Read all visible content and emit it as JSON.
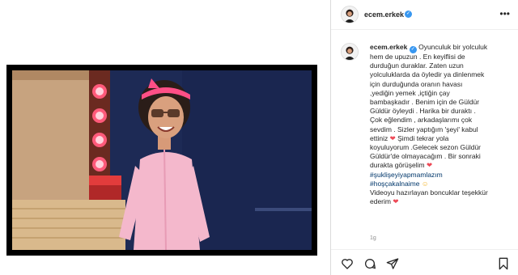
{
  "post": {
    "username": "ecem.erkek",
    "verified": true
  },
  "caption": {
    "username": "ecem.erkek",
    "lines": [
      "Oyunculuk bir yolculuk",
      "hem de upuzun . En keyiflisi de",
      "durduğun duraklar. Zaten uzun",
      "yolculuklarda da öyledir ya dinlenmek",
      "için durduğunda oranın havası",
      ",yediğin yemek ,içtiğin çay",
      "bambaşkadır . Benim için de Güldür",
      "Güldür öyleydi . Harika bir duraktı .",
      "Çok eğlendim , arkadaşlarımı çok",
      "sevdim . Sizler yaptığım 'şeyi' kabul",
      "ettiniz",
      "Şimdi tekrar yola",
      "koyuluyorum .Gelecek sezon Güldür",
      "Güldür'de olmayacağım . Bir sonraki",
      "durakta görüşelim"
    ],
    "hashtags": [
      "#şuklişeyiyapmamlazım",
      "#hoşçakalnaime"
    ],
    "credit_line1": "Videoyu hazırlayan boncuklar teşekkür",
    "credit_line2": "ederim"
  },
  "time_ago": "1g",
  "icons": {
    "verified": "verified-badge-icon",
    "more": "more-options-icon",
    "like": "heart-icon",
    "comment": "comment-icon",
    "share": "share-icon",
    "save": "bookmark-icon",
    "emoji_heart": "red-heart-emoji",
    "emoji_smile": "smile-emoji"
  },
  "colors": {
    "verified": "#3897f0",
    "hashtag": "#00376b",
    "heart": "#ed4956",
    "muted": "#8e8e8e"
  }
}
